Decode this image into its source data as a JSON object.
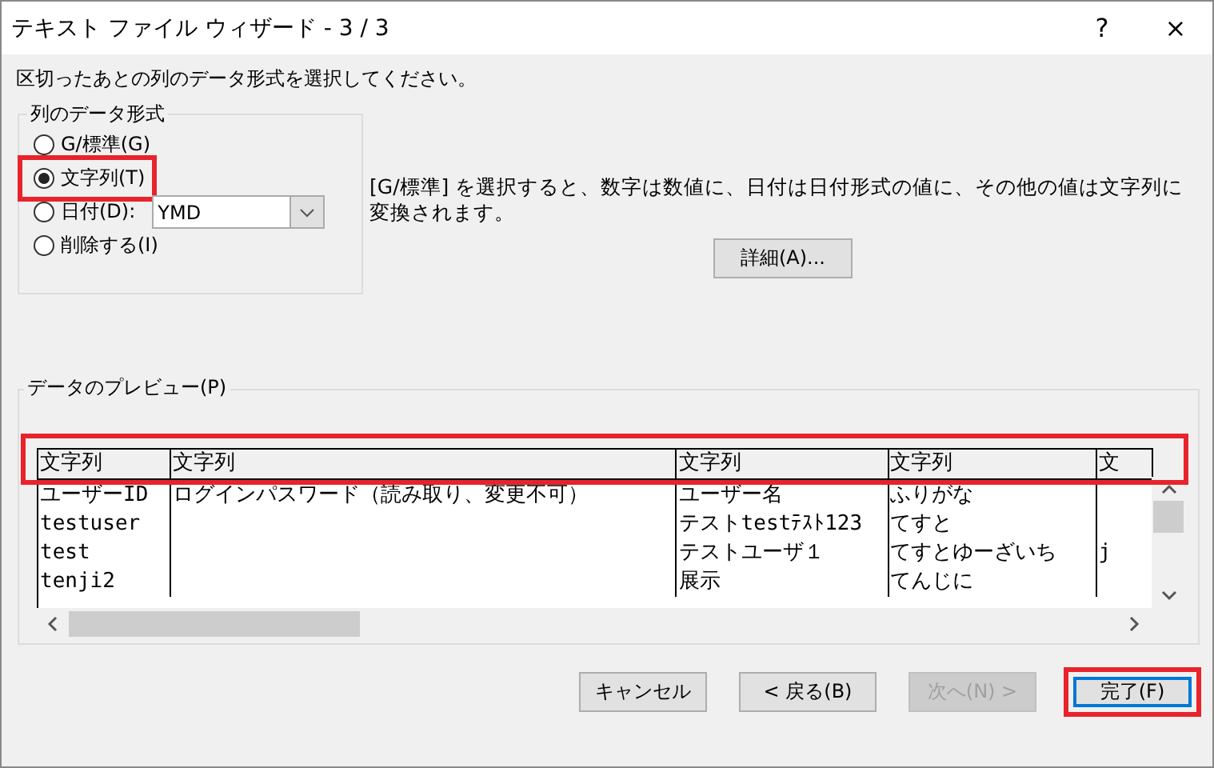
{
  "window": {
    "title": "テキスト ファイル ウィザード - 3 / 3",
    "help": "?",
    "close": "×"
  },
  "instruction": "区切ったあとの列のデータ形式を選択してください。",
  "format_group": {
    "title": "列のデータ形式",
    "options": [
      {
        "label": "G/標準(G)",
        "selected": false,
        "highlighted": false
      },
      {
        "label": "文字列(T)",
        "selected": true,
        "highlighted": true
      },
      {
        "label": "日付(D):",
        "selected": false,
        "highlighted": false,
        "dropdown": "YMD"
      },
      {
        "label": "削除する(I)",
        "selected": false,
        "highlighted": false
      }
    ]
  },
  "description": "[G/標準] を選択すると、数字は数値に、日付は日付形式の値に、その他の値は文字列に変換されます。",
  "advanced_button": "詳細(A)...",
  "preview": {
    "title": "データのプレビュー(P)",
    "header_highlighted": true,
    "columns": [
      "文字列",
      "文字列",
      "文字列",
      "文字列",
      "文"
    ],
    "rows": [
      [
        "ユーザーID",
        "ログインパスワード（読み取り、変更不可）",
        "ユーザー名",
        "ふりがな",
        ""
      ],
      [
        "testuser",
        "",
        "テストtestﾃｽﾄ123",
        "てすと",
        ""
      ],
      [
        "test",
        "",
        "テストユーザ１",
        "てすとゆーざいち",
        "j"
      ],
      [
        "tenji2",
        "",
        "展示",
        "てんじに",
        ""
      ]
    ]
  },
  "buttons": [
    {
      "label": "キャンセル",
      "disabled": false,
      "default": false,
      "highlighted": false
    },
    {
      "label": "< 戻る(B)",
      "disabled": false,
      "default": false,
      "highlighted": false
    },
    {
      "label": "次へ(N) >",
      "disabled": true,
      "default": false,
      "highlighted": false
    },
    {
      "label": "完了(F)",
      "disabled": false,
      "default": true,
      "highlighted": true
    }
  ]
}
